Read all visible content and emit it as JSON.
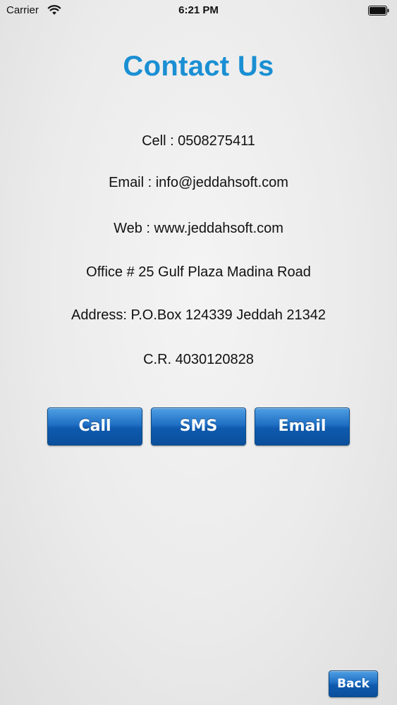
{
  "status_bar": {
    "carrier": "Carrier",
    "time": "6:21 PM",
    "wifi_icon": "wifi-icon",
    "battery_icon": "battery-icon"
  },
  "title": "Contact Us",
  "info": {
    "cell": "Cell : 0508275411",
    "email": "Email : info@jeddahsoft.com",
    "web": "Web : www.jeddahsoft.com",
    "office": "Office # 25 Gulf Plaza Madina Road",
    "address": "Address: P.O.Box 124339 Jeddah 21342",
    "cr": "C.R. 4030120828"
  },
  "buttons": {
    "call": "Call",
    "sms": "SMS",
    "email": "Email",
    "back": "Back"
  },
  "colors": {
    "title": "#1a8fd3",
    "button": "#1a66bf",
    "background": "#ececec"
  }
}
